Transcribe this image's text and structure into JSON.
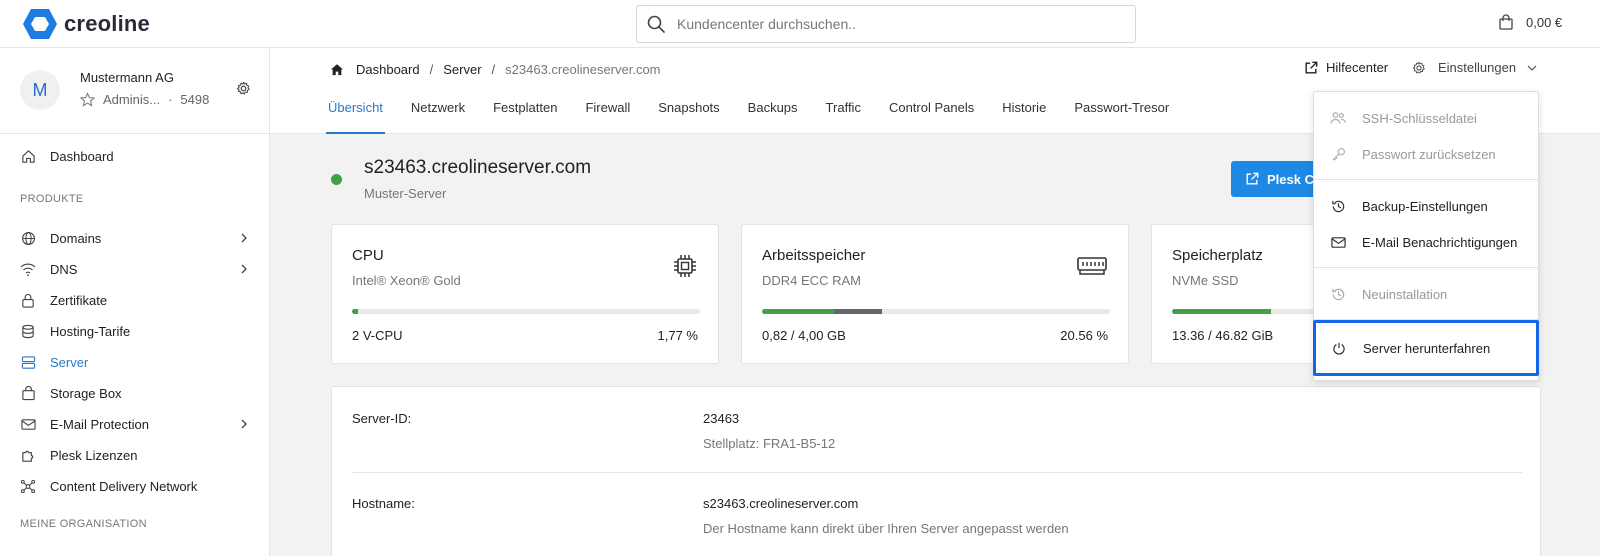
{
  "brand": {
    "name": "creoline",
    "color": "#1e7be0"
  },
  "search": {
    "placeholder": "Kundencenter durchsuchen.."
  },
  "cart": {
    "value": "0,00 €"
  },
  "account": {
    "initial": "M",
    "name": "Mustermann AG",
    "role": "Adminis...",
    "sep": "·",
    "id": "5498"
  },
  "sidebar": {
    "items": [
      {
        "label": "Dashboard",
        "icon": "home-icon"
      },
      {
        "label": "Domains",
        "icon": "globe-icon"
      },
      {
        "label": "DNS",
        "icon": "wifi-icon"
      },
      {
        "label": "Zertifikate",
        "icon": "lock-icon"
      },
      {
        "label": "Hosting-Tarife",
        "icon": "database-icon"
      },
      {
        "label": "Server",
        "icon": "server-icon",
        "active": true
      },
      {
        "label": "Storage Box",
        "icon": "box-icon"
      },
      {
        "label": "E-Mail Protection",
        "icon": "mail-icon"
      },
      {
        "label": "Plesk Lizenzen",
        "icon": "puzzle-icon"
      },
      {
        "label": "Content Delivery Network",
        "icon": "network-icon"
      }
    ],
    "section_products": "PRODUKTE",
    "section_org": "MEINE ORGANISATION"
  },
  "breadcrumb": {
    "home": "Dashboard",
    "server": "Server",
    "current": "s23463.creolineserver.com",
    "sep": "/"
  },
  "header": {
    "help": "Hilfecenter",
    "settings": "Einstellungen"
  },
  "tabs": [
    "Übersicht",
    "Netzwerk",
    "Festplatten",
    "Firewall",
    "Snapshots",
    "Backups",
    "Traffic",
    "Control Panels",
    "Historie",
    "Passwort-Tresor"
  ],
  "server": {
    "hostname": "s23463.creolineserver.com",
    "subtitle": "Muster-Server",
    "status_color": "#43a047",
    "plesk_button": "Plesk Control Panel"
  },
  "cards": [
    {
      "title": "CPU",
      "subtitle": "Intel® Xeon® Gold",
      "left": "2 V-CPU",
      "right": "1,77 %",
      "usage_fraction": 0.0177,
      "icon": "cpu-icon"
    },
    {
      "title": "Arbeitsspeicher",
      "subtitle": "DDR4 ECC RAM",
      "left": "0,82 / 4,00 GB",
      "right": "20.56 %",
      "usage_fraction": 0.2056,
      "secondary_fraction": 0.14,
      "icon": "memory-icon"
    },
    {
      "title": "Speicherplatz",
      "subtitle": "NVMe SSD",
      "left": "13.36 / 46.82 GiB",
      "usage_fraction": 0.2853,
      "icon": "disk-icon"
    }
  ],
  "details": {
    "server_id_label": "Server-ID:",
    "server_id": "23463",
    "location": "Stellplatz: FRA1-B5-12",
    "hostname_label": "Hostname:",
    "hostname": "s23463.creolineserver.com",
    "hostname_hint": "Der Hostname kann direkt über Ihren Server angepasst werden"
  },
  "dropdown": {
    "items": [
      {
        "label": "SSH-Schlüsseldatei",
        "icon": "users-icon",
        "disabled": true
      },
      {
        "label": "Passwort zurücksetzen",
        "icon": "key-icon",
        "disabled": true
      },
      {
        "label": "Backup-Einstellungen",
        "icon": "history-icon"
      },
      {
        "label": "E-Mail Benachrichtigungen",
        "icon": "envelope-icon"
      },
      {
        "label": "Neuinstallation",
        "icon": "history-icon",
        "disabled": true
      },
      {
        "label": "Server herunterfahren",
        "icon": "power-icon",
        "focused": true
      }
    ]
  }
}
